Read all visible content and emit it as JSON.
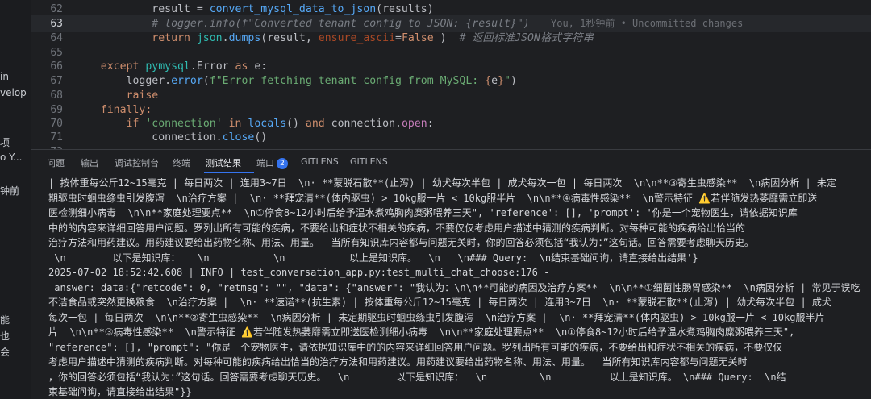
{
  "sidebar": {
    "items": [
      "in",
      "velop",
      "项",
      "o Y...",
      "钟前",
      "能",
      "也",
      "会"
    ]
  },
  "editor": {
    "blame": "You, 1秒钟前 • Uncommitted changes",
    "lines": [
      {
        "num": "62",
        "seg": [
          "            result = ",
          "convert_mysql_data_to_json",
          "(results)"
        ]
      },
      {
        "num": "63",
        "seg": [
          "            ",
          "# logger.info(f\"Converted tenant config to JSON: {result}\")"
        ]
      },
      {
        "num": "64",
        "seg": [
          "            ",
          "return ",
          "json",
          ".",
          "dumps",
          "(result, ",
          "ensure_ascii",
          "=",
          "False",
          " )  ",
          "# 返回标准JSON格式字符串"
        ]
      },
      {
        "num": "65",
        "seg": [
          ""
        ]
      },
      {
        "num": "66",
        "seg": [
          "    ",
          "except ",
          "pymysql",
          ".",
          "Error ",
          "as ",
          "e:"
        ]
      },
      {
        "num": "67",
        "seg": [
          "        logger.",
          "error",
          "(",
          "f\"Error fetching tenant config from MySQL: ",
          "{",
          "e",
          "}",
          "\"",
          ")"
        ]
      },
      {
        "num": "68",
        "seg": [
          "        ",
          "raise"
        ]
      },
      {
        "num": "69",
        "seg": [
          "    ",
          "finally:"
        ]
      },
      {
        "num": "70",
        "seg": [
          "        ",
          "if ",
          "'connection' ",
          "in ",
          "locals",
          "() ",
          "and ",
          "connection.",
          "open",
          ":"
        ]
      },
      {
        "num": "71",
        "seg": [
          "            connection.",
          "close",
          "()"
        ]
      },
      {
        "num": "72",
        "seg": [
          ""
        ]
      }
    ]
  },
  "panel": {
    "tabs": [
      "问题",
      "输出",
      "调试控制台",
      "终端",
      "测试结果",
      "端口",
      "GITLENS",
      "GITLENS"
    ],
    "port_badge": "2",
    "active_tab": "测试结果",
    "output": [
      "| 按体重每公斤12~15毫克 | 每日两次 | 连用3~7日  \\n· **蒙脱石散**(止泻) | 幼犬每次半包 | 成犬每次一包 | 每日两次  \\n\\n**③寄生虫感染**  \\n病因分析 | 未定",
      "期驱虫时蛔虫绦虫引发腹泻  \\n治疗方案 |  \\n· **拜宠清**(体内驱虫) > 10kg服一片 < 10kg服半片  \\n\\n**④病毒性感染**  \\n警示特征 ⚠️若伴随发热萎靡需立即送",
      "医检测细小病毒  \\n\\n**家庭处理要点**  \\n①停食8~12小时后给予温水煮鸡胸肉糜粥喂养三天\", 'reference': [], 'prompt': '你是一个宠物医生，请依据知识库",
      "中的的内容来详细回答用户问题。罗列出所有可能的疾病，不要给出和症状不相关的疾病，不要仅仅考虑用户描述中猜测的疾病判断。对每种可能的疾病给出恰当的",
      "治疗方法和用药建议。用药建议要给出药物名称、用法、用量。  当所有知识库内容都与问题无关时，你的回答必须包括“我认为：”这句话。回答需要考虑聊天历史。",
      " \\n        以下是知识库：   \\n           \\n           以上是知识库。  \\n   \\n### Query:  \\n结束基础问询，请直接给出结果'}",
      "2025-07-02 18:52:42.608 | INFO | test_conversation_app.py:test_multi_chat_choose:176 -",
      "",
      " answer: data:{\"retcode\": 0, \"retmsg\": \"\", \"data\": {\"answer\": \"我认为：\\n\\n**可能的病因及治疗方案**  \\n\\n**①细菌性肠胃感染**  \\n病因分析 | 常见于误吃",
      "不洁食品或突然更换粮食  \\n治疗方案 |  \\n· **速诺**(抗生素) | 按体重每公斤12~15毫克 | 每日两次 | 连用3~7日  \\n· **蒙脱石散**(止泻) | 幼犬每次半包 | 成犬",
      "每次一包 | 每日两次  \\n\\n**②寄生虫感染**  \\n病因分析 | 未定期驱虫时蛔虫绦虫引发腹泻  \\n治疗方案 |  \\n· **拜宠清**(体内驱虫) > 10kg服一片 < 10kg服半片",
      "片  \\n\\n**③病毒性感染**  \\n警示特征 ⚠️若伴随发热萎靡需立即送医检测细小病毒  \\n\\n**家庭处理要点**  \\n①停食8~12小时后给予温水煮鸡胸肉糜粥喂养三天\",",
      "\"reference\": [], \"prompt\": \"你是一个宠物医生，请依据知识库中的的内容来详细回答用户问题。罗列出所有可能的疾病，不要给出和症状不相关的疾病，不要仅仅",
      "考虑用户描述中猜测的疾病判断。对每种可能的疾病给出恰当的治疗方法和用药建议。用药建议要给出药物名称、用法、用量。  当所有知识库内容都与问题无关时",
      "，你的回答必须包括“我认为：”这句话。回答需要考虑聊天历史。  \\n        以下是知识库：  \\n         \\n          以上是知识库。 \\n### Query:  \\n结",
      "束基础问询，请直接给出结果\"}}"
    ]
  },
  "colors": {
    "background": "#1e1f22",
    "keyword": "#cf8e6d",
    "function": "#56a8f5",
    "string": "#6aab73",
    "comment": "#7a7e85",
    "accent": "#3574f0"
  }
}
